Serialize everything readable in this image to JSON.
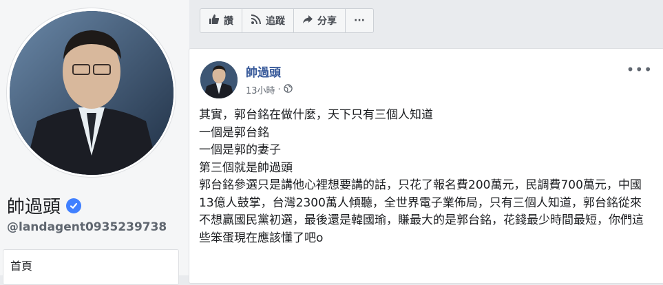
{
  "profile": {
    "name": "帥過頭",
    "handle": "@landagent0935239738",
    "nav_home": "首頁"
  },
  "actions": {
    "like": "讚",
    "follow": "追蹤",
    "share": "分享",
    "more": "···"
  },
  "post": {
    "author": "帥過頭",
    "time": "13小時",
    "separator": "·",
    "lines": [
      "其實，郭台銘在做什麼，天下只有三個人知道",
      "一個是郭台銘",
      "一個是郭的妻子",
      "第三個就是帥過頭",
      "郭台銘參選只是講他心裡想要講的話，只花了報名費200萬元，民調費700萬元，中國13億人鼓掌，台灣2300萬人傾聽，全世界電子業佈局，只有三個人知道，郭台銘從來不想贏國民黨初選，最後還是韓國瑜，賺最大的是郭台銘，花錢最少時間最短，你們這些笨蛋現在應該懂了吧o"
    ],
    "more": "•••"
  },
  "colors": {
    "link_blue": "#365899",
    "verified_blue": "#4080ff",
    "page_bg": "#e9ebee"
  },
  "icons": {
    "like": "thumbs-up-icon",
    "follow": "rss-icon",
    "share": "share-arrow-icon",
    "audience": "globe-icon",
    "verified": "verified-check-icon"
  }
}
